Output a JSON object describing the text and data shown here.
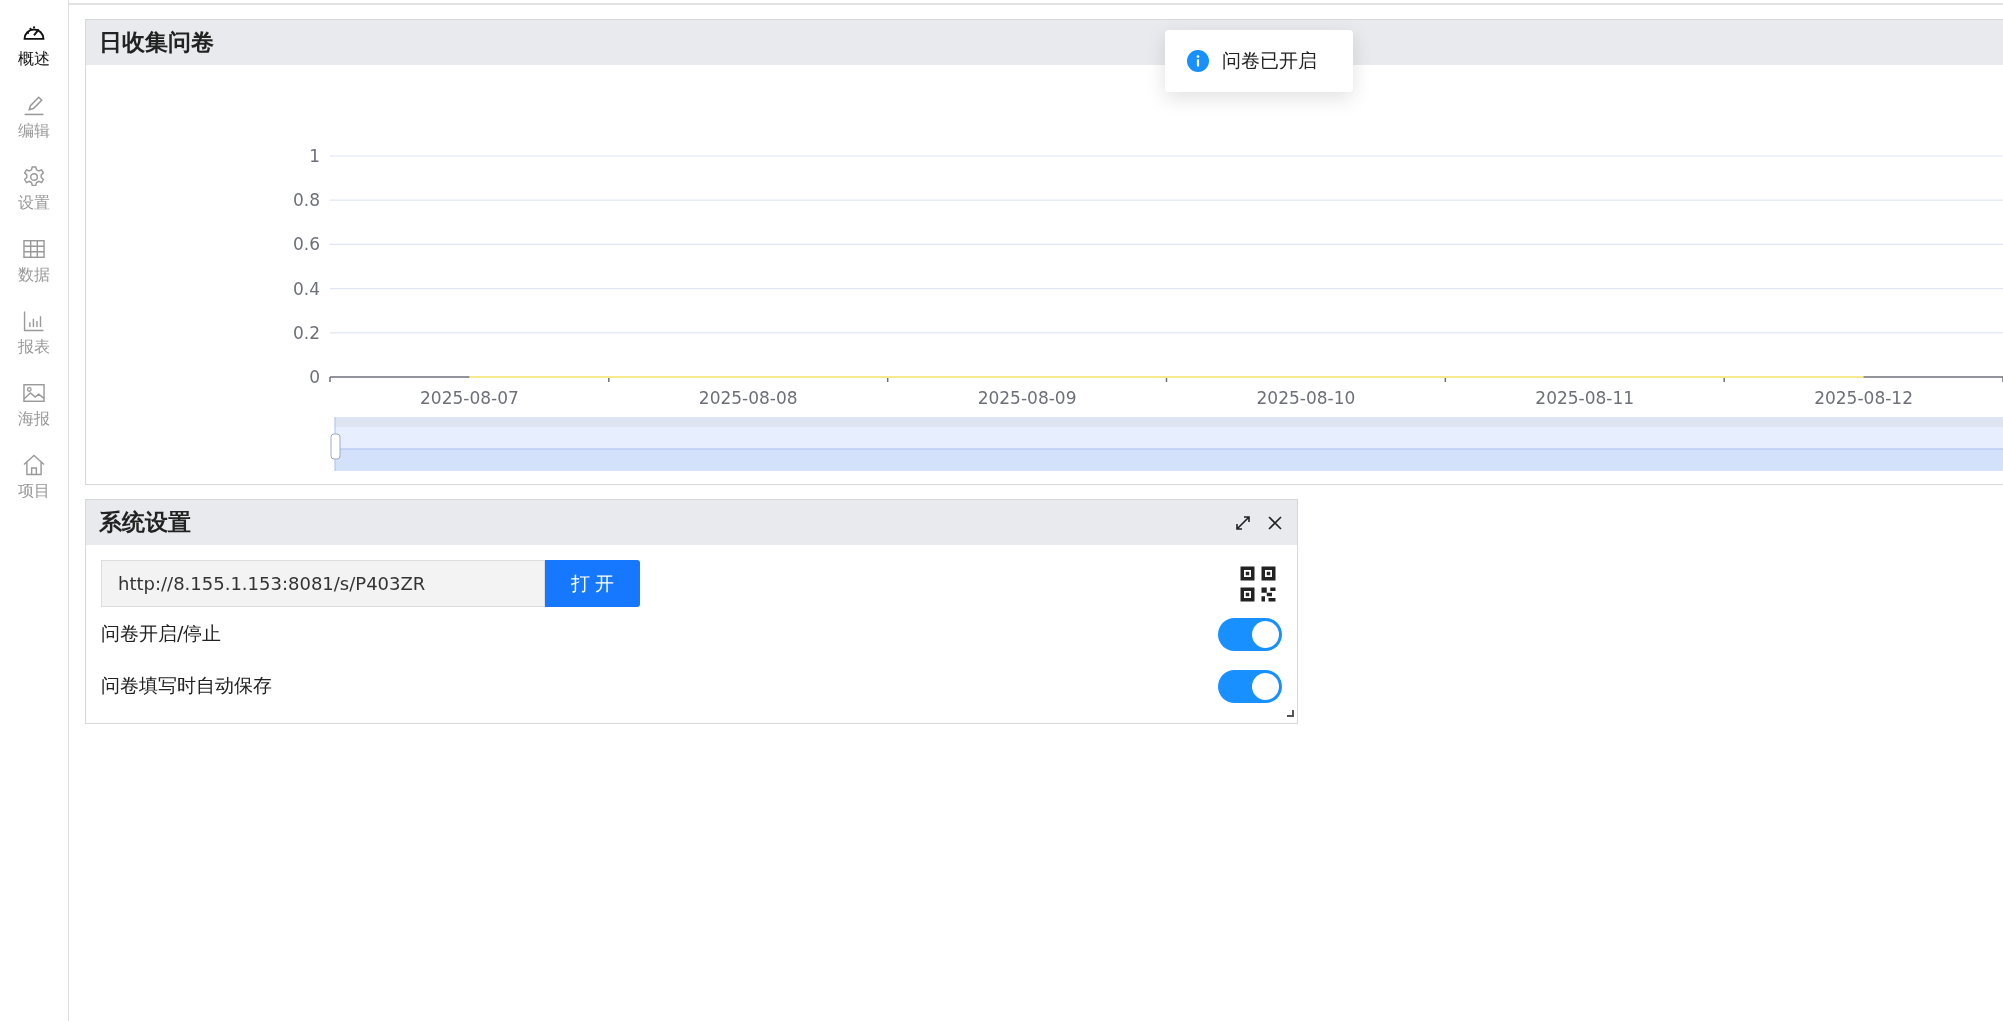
{
  "sidebar": {
    "items": [
      {
        "label": "概述",
        "selected": true
      },
      {
        "label": "编辑",
        "selected": false
      },
      {
        "label": "设置",
        "selected": false
      },
      {
        "label": "数据",
        "selected": false
      },
      {
        "label": "报表",
        "selected": false
      },
      {
        "label": "海报",
        "selected": false
      },
      {
        "label": "项目",
        "selected": false
      }
    ]
  },
  "chart_panel": {
    "title": "日收集问卷",
    "chart_data": {
      "type": "line",
      "grid": true,
      "categories": [
        "2025-08-07",
        "2025-08-08",
        "2025-08-09",
        "2025-08-10",
        "2025-08-11",
        "2025-08-12"
      ],
      "ylim": [
        0,
        1
      ],
      "yticks": [
        0,
        0.2,
        0.4,
        0.6,
        0.8,
        1
      ],
      "series": [
        {
          "color": "#f7e98e",
          "values": [
            0,
            0,
            0,
            0,
            0,
            0
          ]
        }
      ]
    }
  },
  "toast": {
    "text": "问卷已开启"
  },
  "settings_panel": {
    "title": "系统设置",
    "url": "http://8.155.1.153:8081/s/P403ZR",
    "open_button": "打 开",
    "toggles": [
      {
        "label": "问卷开启/停止",
        "on": true
      },
      {
        "label": "问卷填写时自动保存",
        "on": true
      }
    ]
  }
}
